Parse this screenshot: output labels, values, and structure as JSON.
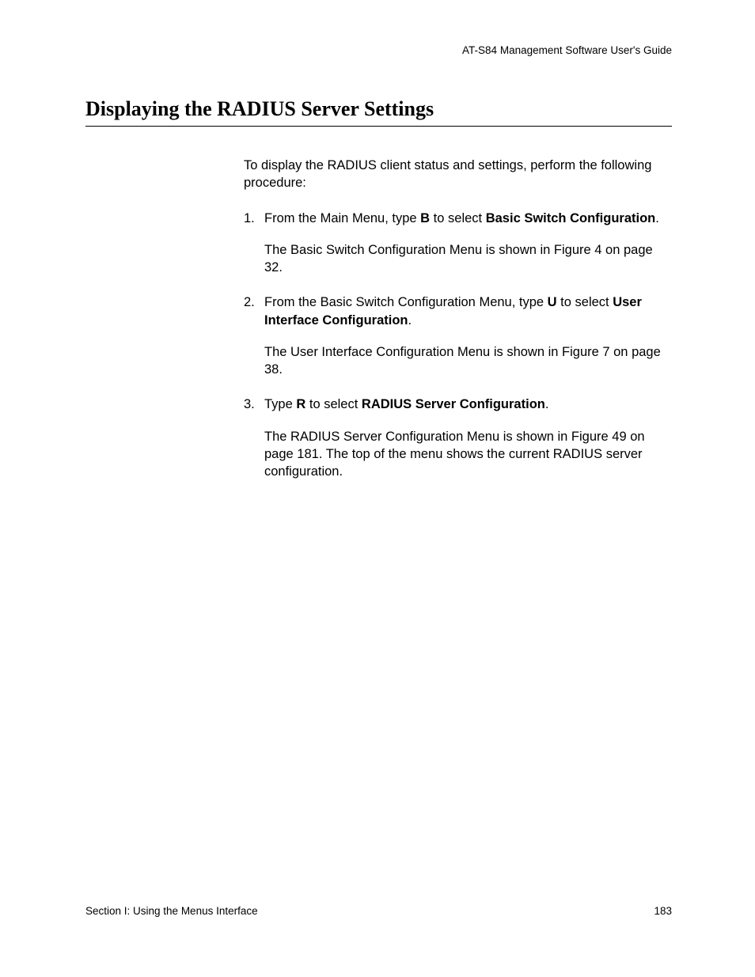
{
  "header": {
    "guide": "AT-S84 Management Software User's Guide"
  },
  "title": "Displaying the RADIUS Server Settings",
  "intro": "To display the RADIUS client status and settings, perform the following procedure:",
  "steps": [
    {
      "num": "1.",
      "text_before_bold1": "From the Main Menu, type ",
      "bold1": "B",
      "text_mid": " to select ",
      "bold2": "Basic Switch Configuration",
      "text_after": ".",
      "note": "The Basic Switch Configuration Menu is shown in Figure 4 on page 32."
    },
    {
      "num": "2.",
      "text_before_bold1": "From the Basic Switch Configuration Menu, type ",
      "bold1": "U",
      "text_mid": " to select ",
      "bold2": "User Interface Configuration",
      "text_after": ".",
      "note": "The User Interface Configuration Menu is shown in Figure 7 on page 38."
    },
    {
      "num": "3.",
      "text_before_bold1": "Type ",
      "bold1": "R",
      "text_mid": " to select ",
      "bold2": "RADIUS Server Configuration",
      "text_after": ".",
      "note": "The RADIUS Server Configuration Menu is shown in Figure 49 on page 181. The top of the menu shows the current RADIUS server configuration."
    }
  ],
  "footer": {
    "section": "Section I: Using the Menus Interface",
    "page": "183"
  }
}
